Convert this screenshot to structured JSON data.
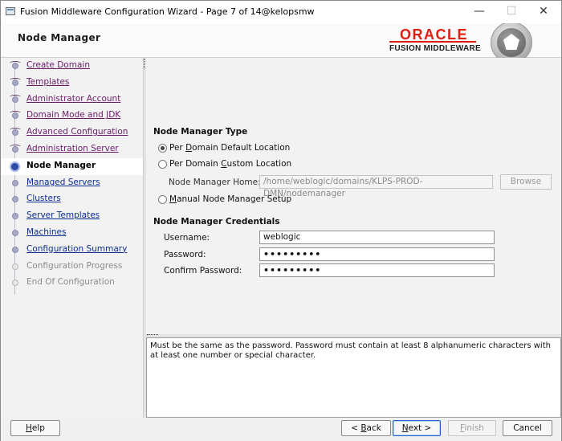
{
  "window": {
    "title": "Fusion Middleware Configuration Wizard - Page 7 of 14@kelopsmw",
    "minimize_glyph": "—",
    "maximize_glyph": "☐",
    "close_glyph": "✕"
  },
  "header": {
    "page_title": "Node Manager",
    "logo_oracle": "ORACLE",
    "logo_fusion": "FUSION MIDDLEWARE"
  },
  "nav": {
    "items": [
      {
        "label": "Create Domain",
        "state": "done"
      },
      {
        "label": "Templates",
        "state": "done"
      },
      {
        "label": "Administrator Account",
        "state": "done"
      },
      {
        "label": "Domain Mode and JDK",
        "state": "done"
      },
      {
        "label": "Advanced Configuration",
        "state": "done"
      },
      {
        "label": "Administration Server",
        "state": "done"
      },
      {
        "label": "Node Manager",
        "state": "current"
      },
      {
        "label": "Managed Servers",
        "state": "todo"
      },
      {
        "label": "Clusters",
        "state": "todo"
      },
      {
        "label": "Server Templates",
        "state": "todo"
      },
      {
        "label": "Machines",
        "state": "todo"
      },
      {
        "label": "Configuration Summary",
        "state": "todo"
      },
      {
        "label": "Configuration Progress",
        "state": "disabled"
      },
      {
        "label": "End Of Configuration",
        "state": "disabled"
      }
    ]
  },
  "node_manager_type": {
    "title": "Node Manager Type",
    "per_domain_default": {
      "pre": "Per ",
      "ul": "D",
      "post": "omain Default Location",
      "checked": true
    },
    "per_domain_custom": {
      "pre": "Per Domain ",
      "ul": "C",
      "post": "ustom Location",
      "checked": false
    },
    "home_label": "Node Manager Home:",
    "home_value": "/home/weblogic/domains/KLPS-PROD-DMN/nodemanager",
    "browse_label": "Browse",
    "manual": {
      "pre": "",
      "ul": "M",
      "post": "anual Node Manager Setup",
      "checked": false
    }
  },
  "credentials": {
    "title": "Node Manager Credentials",
    "username_label": "Username:",
    "username_value": "weblogic",
    "password_label": "Password:",
    "password_value": "•••••••••",
    "confirm_label": "Confirm Password:",
    "confirm_value": "•••••••••"
  },
  "help": {
    "text": "Must be the same as the password. Password must contain at least 8 alphanumeric characters with at least one number or special character."
  },
  "buttons": {
    "help": {
      "ul": "H",
      "post": "elp"
    },
    "back": {
      "pre": "< ",
      "ul": "B",
      "post": "ack"
    },
    "next": {
      "ul": "N",
      "post": "ext >"
    },
    "finish": {
      "ul": "F",
      "post": "inish"
    },
    "cancel": "Cancel"
  }
}
